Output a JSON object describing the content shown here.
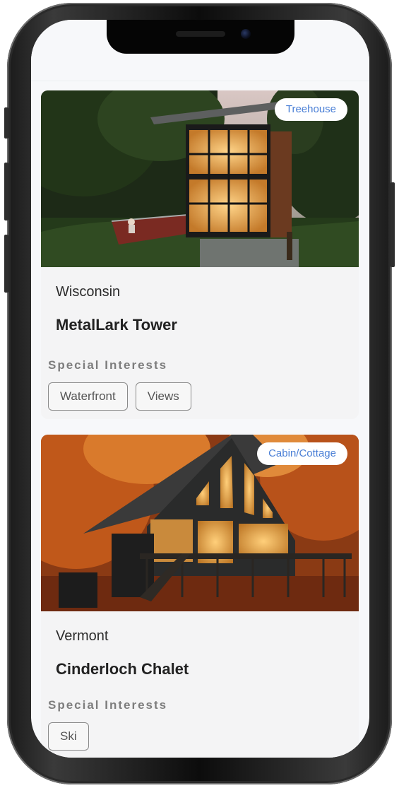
{
  "listings": [
    {
      "category": "Treehouse",
      "location": "Wisconsin",
      "name": "MetalLark Tower",
      "interests_label": "Special Interests",
      "interests": [
        "Waterfront",
        "Views"
      ]
    },
    {
      "category": "Cabin/Cottage",
      "location": "Vermont",
      "name": "Cinderloch Chalet",
      "interests_label": "Special Interests",
      "interests": [
        "Ski"
      ]
    }
  ],
  "colors": {
    "tag_text": "#4a7fd6",
    "card_bg": "#f4f4f5",
    "chip_border": "#8a8a8a"
  }
}
